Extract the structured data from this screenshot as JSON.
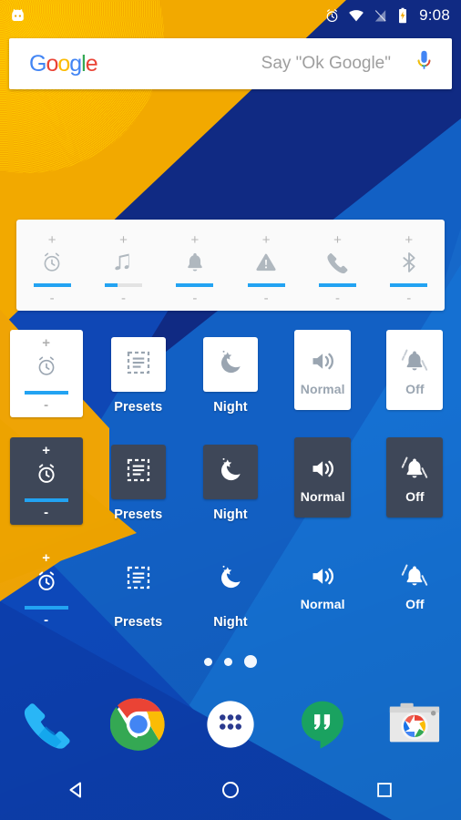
{
  "status_bar": {
    "brand_icon": "cyanogenmod-robot-icon",
    "icons": [
      "alarm-icon",
      "wifi-icon",
      "signal-off-icon",
      "battery-charging-icon"
    ],
    "clock": "9:08"
  },
  "search": {
    "logo_letters": [
      {
        "ch": "G",
        "color": "#4285f4"
      },
      {
        "ch": "o",
        "color": "#ea4335"
      },
      {
        "ch": "o",
        "color": "#fbbc05"
      },
      {
        "ch": "g",
        "color": "#4285f4"
      },
      {
        "ch": "l",
        "color": "#34a853"
      },
      {
        "ch": "e",
        "color": "#ea4335"
      }
    ],
    "placeholder": "Say \"Ok Google\"",
    "mic_icon": "microphone-icon"
  },
  "volume_panel": {
    "plus": "+",
    "minus": "-",
    "streams": [
      {
        "name": "alarm",
        "icon": "alarm-clock-icon",
        "level": 100
      },
      {
        "name": "music",
        "icon": "music-note-icon",
        "level": 35
      },
      {
        "name": "notification",
        "icon": "bell-icon",
        "level": 100
      },
      {
        "name": "alert",
        "icon": "warning-triangle-icon",
        "level": 100
      },
      {
        "name": "call",
        "icon": "phone-handset-icon",
        "level": 100
      },
      {
        "name": "bluetooth",
        "icon": "bluetooth-icon",
        "level": 100
      }
    ]
  },
  "tile_rows": [
    {
      "style": "white",
      "tiles": [
        {
          "type": "volume",
          "icon": "alarm-clock-icon",
          "level": 100,
          "plus": "+",
          "minus": "-"
        },
        {
          "type": "tile",
          "icon": "presets-icon",
          "label": "Presets",
          "label_pos": "outside"
        },
        {
          "type": "tile",
          "icon": "night-moon-icon",
          "label": "Night",
          "label_pos": "outside"
        },
        {
          "type": "tile",
          "icon": "speaker-normal-icon",
          "label": "Normal",
          "label_pos": "inside"
        },
        {
          "type": "tile",
          "icon": "bell-vibrate-off-icon",
          "label": "Off",
          "label_pos": "inside"
        }
      ]
    },
    {
      "style": "dark",
      "tiles": [
        {
          "type": "volume",
          "icon": "alarm-clock-icon",
          "level": 100,
          "plus": "+",
          "minus": "-"
        },
        {
          "type": "tile",
          "icon": "presets-icon",
          "label": "Presets",
          "label_pos": "outside"
        },
        {
          "type": "tile",
          "icon": "night-moon-icon",
          "label": "Night",
          "label_pos": "outside"
        },
        {
          "type": "tile",
          "icon": "speaker-normal-icon",
          "label": "Normal",
          "label_pos": "inside"
        },
        {
          "type": "tile",
          "icon": "bell-vibrate-off-icon",
          "label": "Off",
          "label_pos": "inside"
        }
      ]
    },
    {
      "style": "transparent",
      "tiles": [
        {
          "type": "volume",
          "icon": "alarm-clock-icon",
          "level": 100,
          "plus": "+",
          "minus": "-"
        },
        {
          "type": "tile",
          "icon": "presets-icon",
          "label": "Presets",
          "label_pos": "outside"
        },
        {
          "type": "tile",
          "icon": "night-moon-icon",
          "label": "Night",
          "label_pos": "outside"
        },
        {
          "type": "tile",
          "icon": "speaker-normal-icon",
          "label": "Normal",
          "label_pos": "inside"
        },
        {
          "type": "tile",
          "icon": "bell-vibrate-off-icon",
          "label": "Off",
          "label_pos": "inside"
        }
      ]
    }
  ],
  "page_indicator": {
    "count": 3,
    "active_index": 2
  },
  "dock": {
    "items": [
      {
        "name": "phone-app-icon",
        "label": "Phone"
      },
      {
        "name": "chrome-app-icon",
        "label": "Chrome"
      },
      {
        "name": "app-drawer-icon",
        "label": "Apps"
      },
      {
        "name": "hangouts-app-icon",
        "label": "Hangouts"
      },
      {
        "name": "camera-app-icon",
        "label": "Camera"
      }
    ]
  },
  "navigation_bar": {
    "items": [
      {
        "name": "back-button",
        "icon": "back-triangle-icon"
      },
      {
        "name": "home-button",
        "icon": "home-circle-icon"
      },
      {
        "name": "recents-button",
        "icon": "recents-square-icon"
      }
    ]
  },
  "colors": {
    "accent_blue": "#22a3f2",
    "wallpaper_amber": "#f2a900",
    "wallpaper_navy": "#102a83",
    "tile_dark": "#3e4758",
    "tile_white": "#ffffff"
  }
}
